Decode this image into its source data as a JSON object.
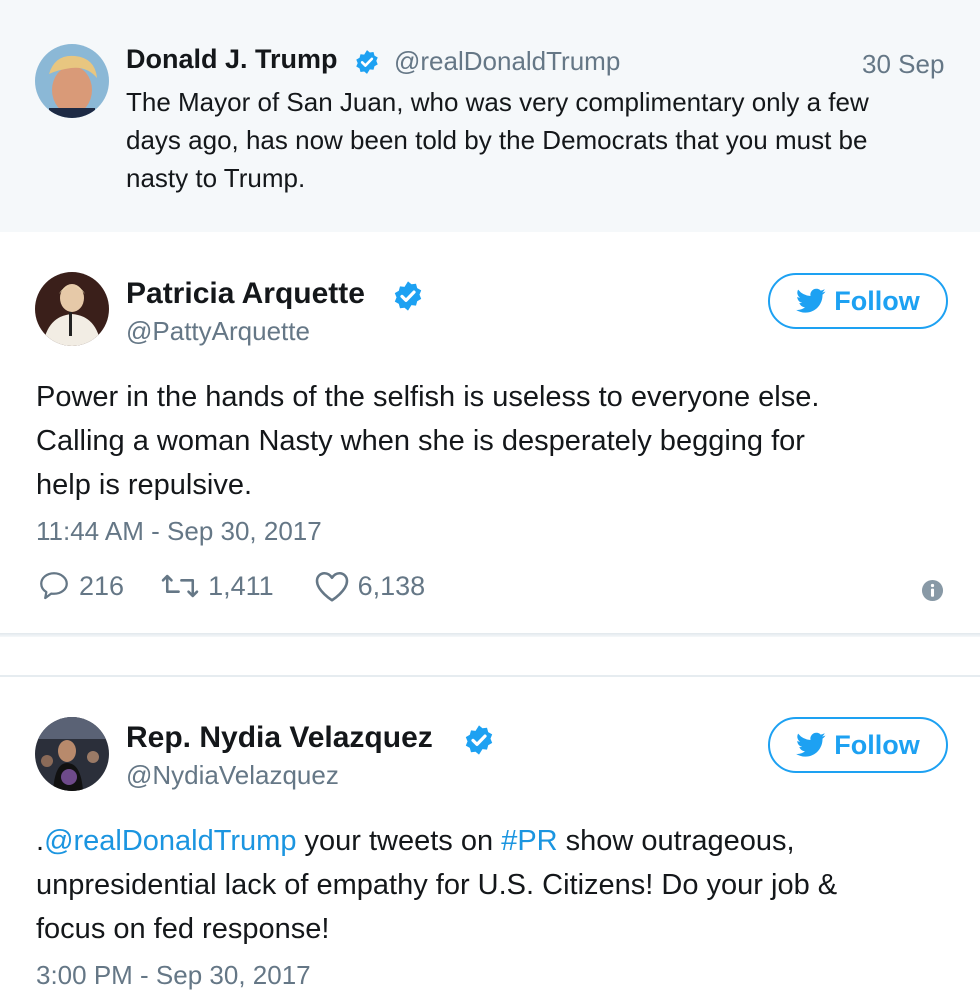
{
  "quoted_tweet": {
    "name": "Donald J. Trump",
    "handle": "@realDonaldTrump",
    "date": "30 Sep",
    "lines": [
      "The Mayor of San Juan, who was very complimentary only a few",
      "days ago, has now been told by the Democrats that you must be",
      "nasty to Trump."
    ]
  },
  "tweet1": {
    "name": "Patricia Arquette",
    "handle": "@PattyArquette",
    "follow_label": "Follow",
    "lines": [
      "Power in the hands of the selfish is useless to everyone else.",
      "Calling a woman Nasty when she is desperately begging for",
      "help is repulsive."
    ],
    "timestamp": "11:44 AM - Sep 30, 2017",
    "replies": "216",
    "retweets": "1,411",
    "likes": "6,138"
  },
  "tweet2": {
    "name": "Rep. Nydia Velazquez",
    "handle": "@NydiaVelazquez",
    "follow_label": "Follow",
    "line1": {
      "prefix": ".",
      "mention": "@realDonaldTrump",
      "mid": " your tweets on ",
      "hashtag": "#PR",
      "suffix": " show outrageous,"
    },
    "lines_rest": [
      "unpresidential lack of empathy for U.S. Citizens! Do your job &",
      "focus on fed response!"
    ],
    "timestamp": "3:00 PM - Sep 30, 2017"
  },
  "colors": {
    "verified": "#1da1f2",
    "link": "#1b95e0",
    "muted": "#657786",
    "quoted_bg": "#f5f8fa"
  },
  "icons": [
    "verified-badge-icon",
    "twitter-bird-icon",
    "reply-icon",
    "retweet-icon",
    "like-icon",
    "info-icon"
  ]
}
